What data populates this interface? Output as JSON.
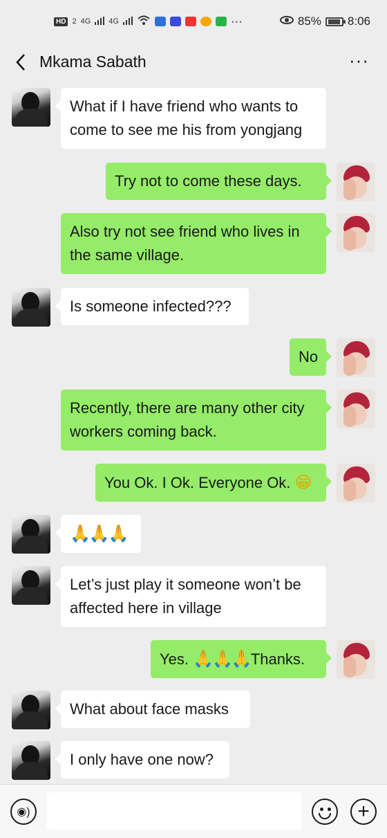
{
  "status_bar": {
    "hd_badge": "HD",
    "hd_sub": "2",
    "net1": "4G",
    "net2": "4G",
    "overflow": "···",
    "battery_percent": "85%",
    "time": "8:06",
    "icons": [
      "eye-comfort-icon",
      "wifi-icon",
      "signal-icon",
      "battery-icon"
    ]
  },
  "header": {
    "title": "Mkama Sabath",
    "back_icon": "chevron-left-icon",
    "more_icon": "more-dots-icon",
    "more_label": "···"
  },
  "messages": [
    {
      "sender": "them",
      "lines": [
        "What if I have friend who wants to",
        "come to see me his from yongjang"
      ]
    },
    {
      "sender": "me",
      "lines": [
        "Try not to come these days."
      ]
    },
    {
      "sender": "me",
      "lines": [
        "Also try not see friend who lives in",
        "the same village."
      ]
    },
    {
      "sender": "them",
      "lines": [
        "Is someone infected???"
      ]
    },
    {
      "sender": "me",
      "lines": [
        "No"
      ]
    },
    {
      "sender": "me",
      "lines": [
        "Recently, there are many other city",
        "workers coming back."
      ]
    },
    {
      "sender": "me",
      "lines": [
        "You Ok. I Ok. Everyone Ok."
      ],
      "trailing_emoji": "😁"
    },
    {
      "sender": "them",
      "lines": [
        "🙏🙏🙏"
      ]
    },
    {
      "sender": "them",
      "lines": [
        "Let’s just play it someone won’t be",
        "affected here in village"
      ]
    },
    {
      "sender": "me",
      "prefix": "Yes. ",
      "emoji": "🙏🙏🙏",
      "suffix": "Thanks."
    },
    {
      "sender": "them",
      "lines": [
        "What about face masks"
      ]
    },
    {
      "sender": "them",
      "lines": [
        "I only have one now?"
      ]
    }
  ],
  "input_bar": {
    "voice_icon": "voice-icon",
    "voice_glyph": "◉)",
    "text_value": "",
    "emoji_icon": "emoji-smile-icon",
    "plus_icon": "plus-icon",
    "plus_glyph": "+"
  },
  "colors": {
    "background": "#ededed",
    "my_bubble": "#95ec69",
    "their_bubble": "#ffffff"
  }
}
